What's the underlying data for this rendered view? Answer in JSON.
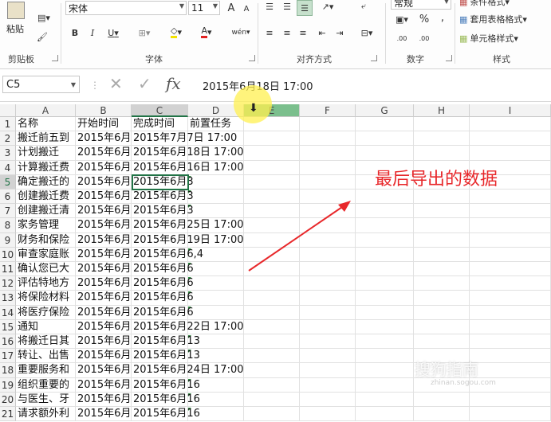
{
  "ribbon": {
    "clipboard": {
      "paste_label": "粘贴",
      "group_label": "剪贴板"
    },
    "font": {
      "font_name": "宋体",
      "font_size": "11",
      "grow_label": "A",
      "shrink_label": "A",
      "bold": "B",
      "italic": "I",
      "underline": "U",
      "font_color_label": "A",
      "group_label": "字体"
    },
    "align": {
      "group_label": "对齐方式"
    },
    "number": {
      "format_value": "常规",
      "percent": "%",
      "comma": ",",
      "inc_decimal": ".00",
      "dec_decimal": ".00",
      "group_label": "数字"
    },
    "styles": {
      "cond_format": "条件格式",
      "table_format": "套用表格格式",
      "cell_style": "单元格样式",
      "group_label": "样式"
    }
  },
  "formula_bar": {
    "name_box": "C5",
    "fx_label": "fx",
    "cancel": "✕",
    "confirm": "✓",
    "content": "2015年6月18日 17:00"
  },
  "columns": [
    "A",
    "B",
    "C",
    "D",
    "E",
    "F",
    "G",
    "H",
    "I"
  ],
  "rows": [
    {
      "num": "1",
      "a": "名称",
      "b": "开始时间",
      "c": "完成时间",
      "d": "前置任务"
    },
    {
      "num": "2",
      "a": "搬迁前五到",
      "b": "2015年6月",
      "c": "2015年7月7日 17:00",
      "d": ""
    },
    {
      "num": "3",
      "a": "计划搬迁",
      "b": "2015年6月",
      "c": "2015年6月18日 17:00",
      "d": ""
    },
    {
      "num": "4",
      "a": "计算搬迁费",
      "b": "2015年6月",
      "c": "2015年6月16日 17:00",
      "d": ""
    },
    {
      "num": "5",
      "a": "确定搬迁的",
      "b": "2015年6月",
      "c": "2015年6月3",
      "d": ""
    },
    {
      "num": "6",
      "a": "创建搬迁费",
      "b": "2015年6月",
      "c": "2015年6月3",
      "d": ""
    },
    {
      "num": "7",
      "a": "创建搬迁清",
      "b": "2015年6月",
      "c": "2015年6月3",
      "d": ""
    },
    {
      "num": "8",
      "a": "家务管理",
      "b": "2015年6月",
      "c": "2015年6月25日 17:00",
      "d": ""
    },
    {
      "num": "9",
      "a": "财务和保险",
      "b": "2015年6月",
      "c": "2015年6月19日 17:00",
      "d": ""
    },
    {
      "num": "10",
      "a": "审查家庭账",
      "b": "2015年6月",
      "c": "2015年6月6,4",
      "d": ""
    },
    {
      "num": "11",
      "a": "确认您已大",
      "b": "2015年6月",
      "c": "2015年6月6",
      "d": ""
    },
    {
      "num": "12",
      "a": "评估特地方",
      "b": "2015年6月",
      "c": "2015年6月6",
      "d": ""
    },
    {
      "num": "13",
      "a": "将保险材料",
      "b": "2015年6月",
      "c": "2015年6月6",
      "d": ""
    },
    {
      "num": "14",
      "a": "将医疗保险",
      "b": "2015年6月",
      "c": "2015年6月6",
      "d": ""
    },
    {
      "num": "15",
      "a": "通知",
      "b": "2015年6月",
      "c": "2015年6月22日 17:00",
      "d": ""
    },
    {
      "num": "16",
      "a": "将搬迁日其",
      "b": "2015年6月",
      "c": "2015年6月13",
      "d": ""
    },
    {
      "num": "17",
      "a": "转让、出售",
      "b": "2015年6月",
      "c": "2015年6月13",
      "d": ""
    },
    {
      "num": "18",
      "a": "重要服务和",
      "b": "2015年6月",
      "c": "2015年6月24日 17:00",
      "d": ""
    },
    {
      "num": "19",
      "a": "组织重要的",
      "b": "2015年6月",
      "c": "2015年6月16",
      "d": ""
    },
    {
      "num": "20",
      "a": "与医生、牙",
      "b": "2015年6月",
      "c": "2015年6月16",
      "d": ""
    },
    {
      "num": "21",
      "a": "请求额外利",
      "b": "2015年6月",
      "c": "2015年6月16",
      "d": ""
    }
  ],
  "annotation": "最后导出的数据",
  "watermark": "搜狗指南",
  "watermark_url": "zhinan.sogou.com",
  "colors": {
    "accent": "#217346",
    "annotation": "#e8282b"
  }
}
